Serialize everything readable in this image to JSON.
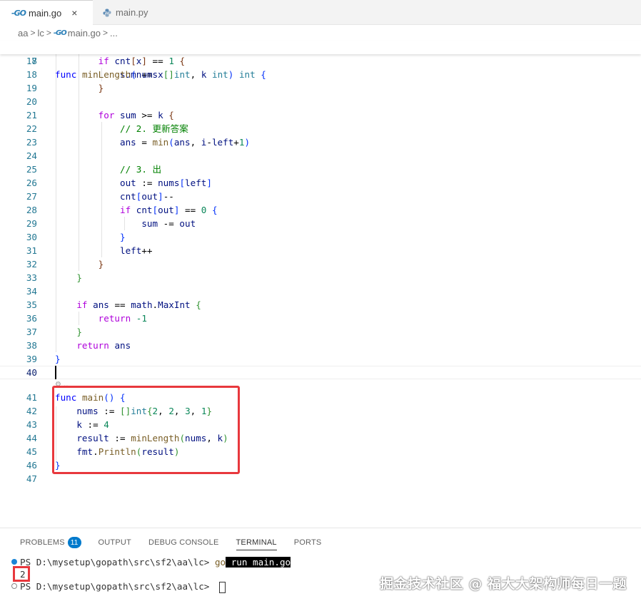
{
  "tabs": [
    {
      "label": "main.go",
      "icon": "go-icon",
      "active": true,
      "close": "×"
    },
    {
      "label": "main.py",
      "icon": "python-icon",
      "active": false
    }
  ],
  "go_glyph": "-GO",
  "breadcrumb": [
    "aa",
    "lc",
    "main.go",
    "..."
  ],
  "code": {
    "sticky": {
      "n": "8",
      "text": "func minLength(nums []int, k int) int {"
    },
    "lines": [
      {
        "n": "17"
      },
      {
        "n": "18"
      },
      {
        "n": "19"
      },
      {
        "n": "20"
      },
      {
        "n": "21"
      },
      {
        "n": "22"
      },
      {
        "n": "23"
      },
      {
        "n": "24"
      },
      {
        "n": "25"
      },
      {
        "n": "26"
      },
      {
        "n": "27"
      },
      {
        "n": "28"
      },
      {
        "n": "29"
      },
      {
        "n": "30"
      },
      {
        "n": "31"
      },
      {
        "n": "32"
      },
      {
        "n": "33"
      },
      {
        "n": "34"
      },
      {
        "n": "35"
      },
      {
        "n": "36"
      },
      {
        "n": "37"
      },
      {
        "n": "38"
      },
      {
        "n": "39"
      },
      {
        "n": "40"
      },
      {
        "n": "41"
      },
      {
        "n": "42"
      },
      {
        "n": "43"
      },
      {
        "n": "44"
      },
      {
        "n": "45"
      },
      {
        "n": "46"
      },
      {
        "n": "47"
      }
    ],
    "comment_22": "// 2. 更新答案",
    "comment_25": "// 3. 出",
    "codelens": "⚙ .."
  },
  "panel": {
    "tabs": [
      {
        "label": "PROBLEMS",
        "badge": "11"
      },
      {
        "label": "OUTPUT"
      },
      {
        "label": "DEBUG CONSOLE"
      },
      {
        "label": "TERMINAL",
        "active": true
      },
      {
        "label": "PORTS"
      }
    ]
  },
  "terminal": {
    "prompt1": "PS D:\\mysetup\\gopath\\src\\sf2\\aa\\lc> ",
    "cmd_go": "go",
    "cmd_rest": " run main.go",
    "output": "2",
    "prompt2": "PS D:\\mysetup\\gopath\\src\\sf2\\aa\\lc> "
  },
  "watermark": "掘金技术社区 @ 福大大架构师每日一题",
  "colors": {
    "accent": "#007acc",
    "highlight_red": "#e8383d"
  }
}
